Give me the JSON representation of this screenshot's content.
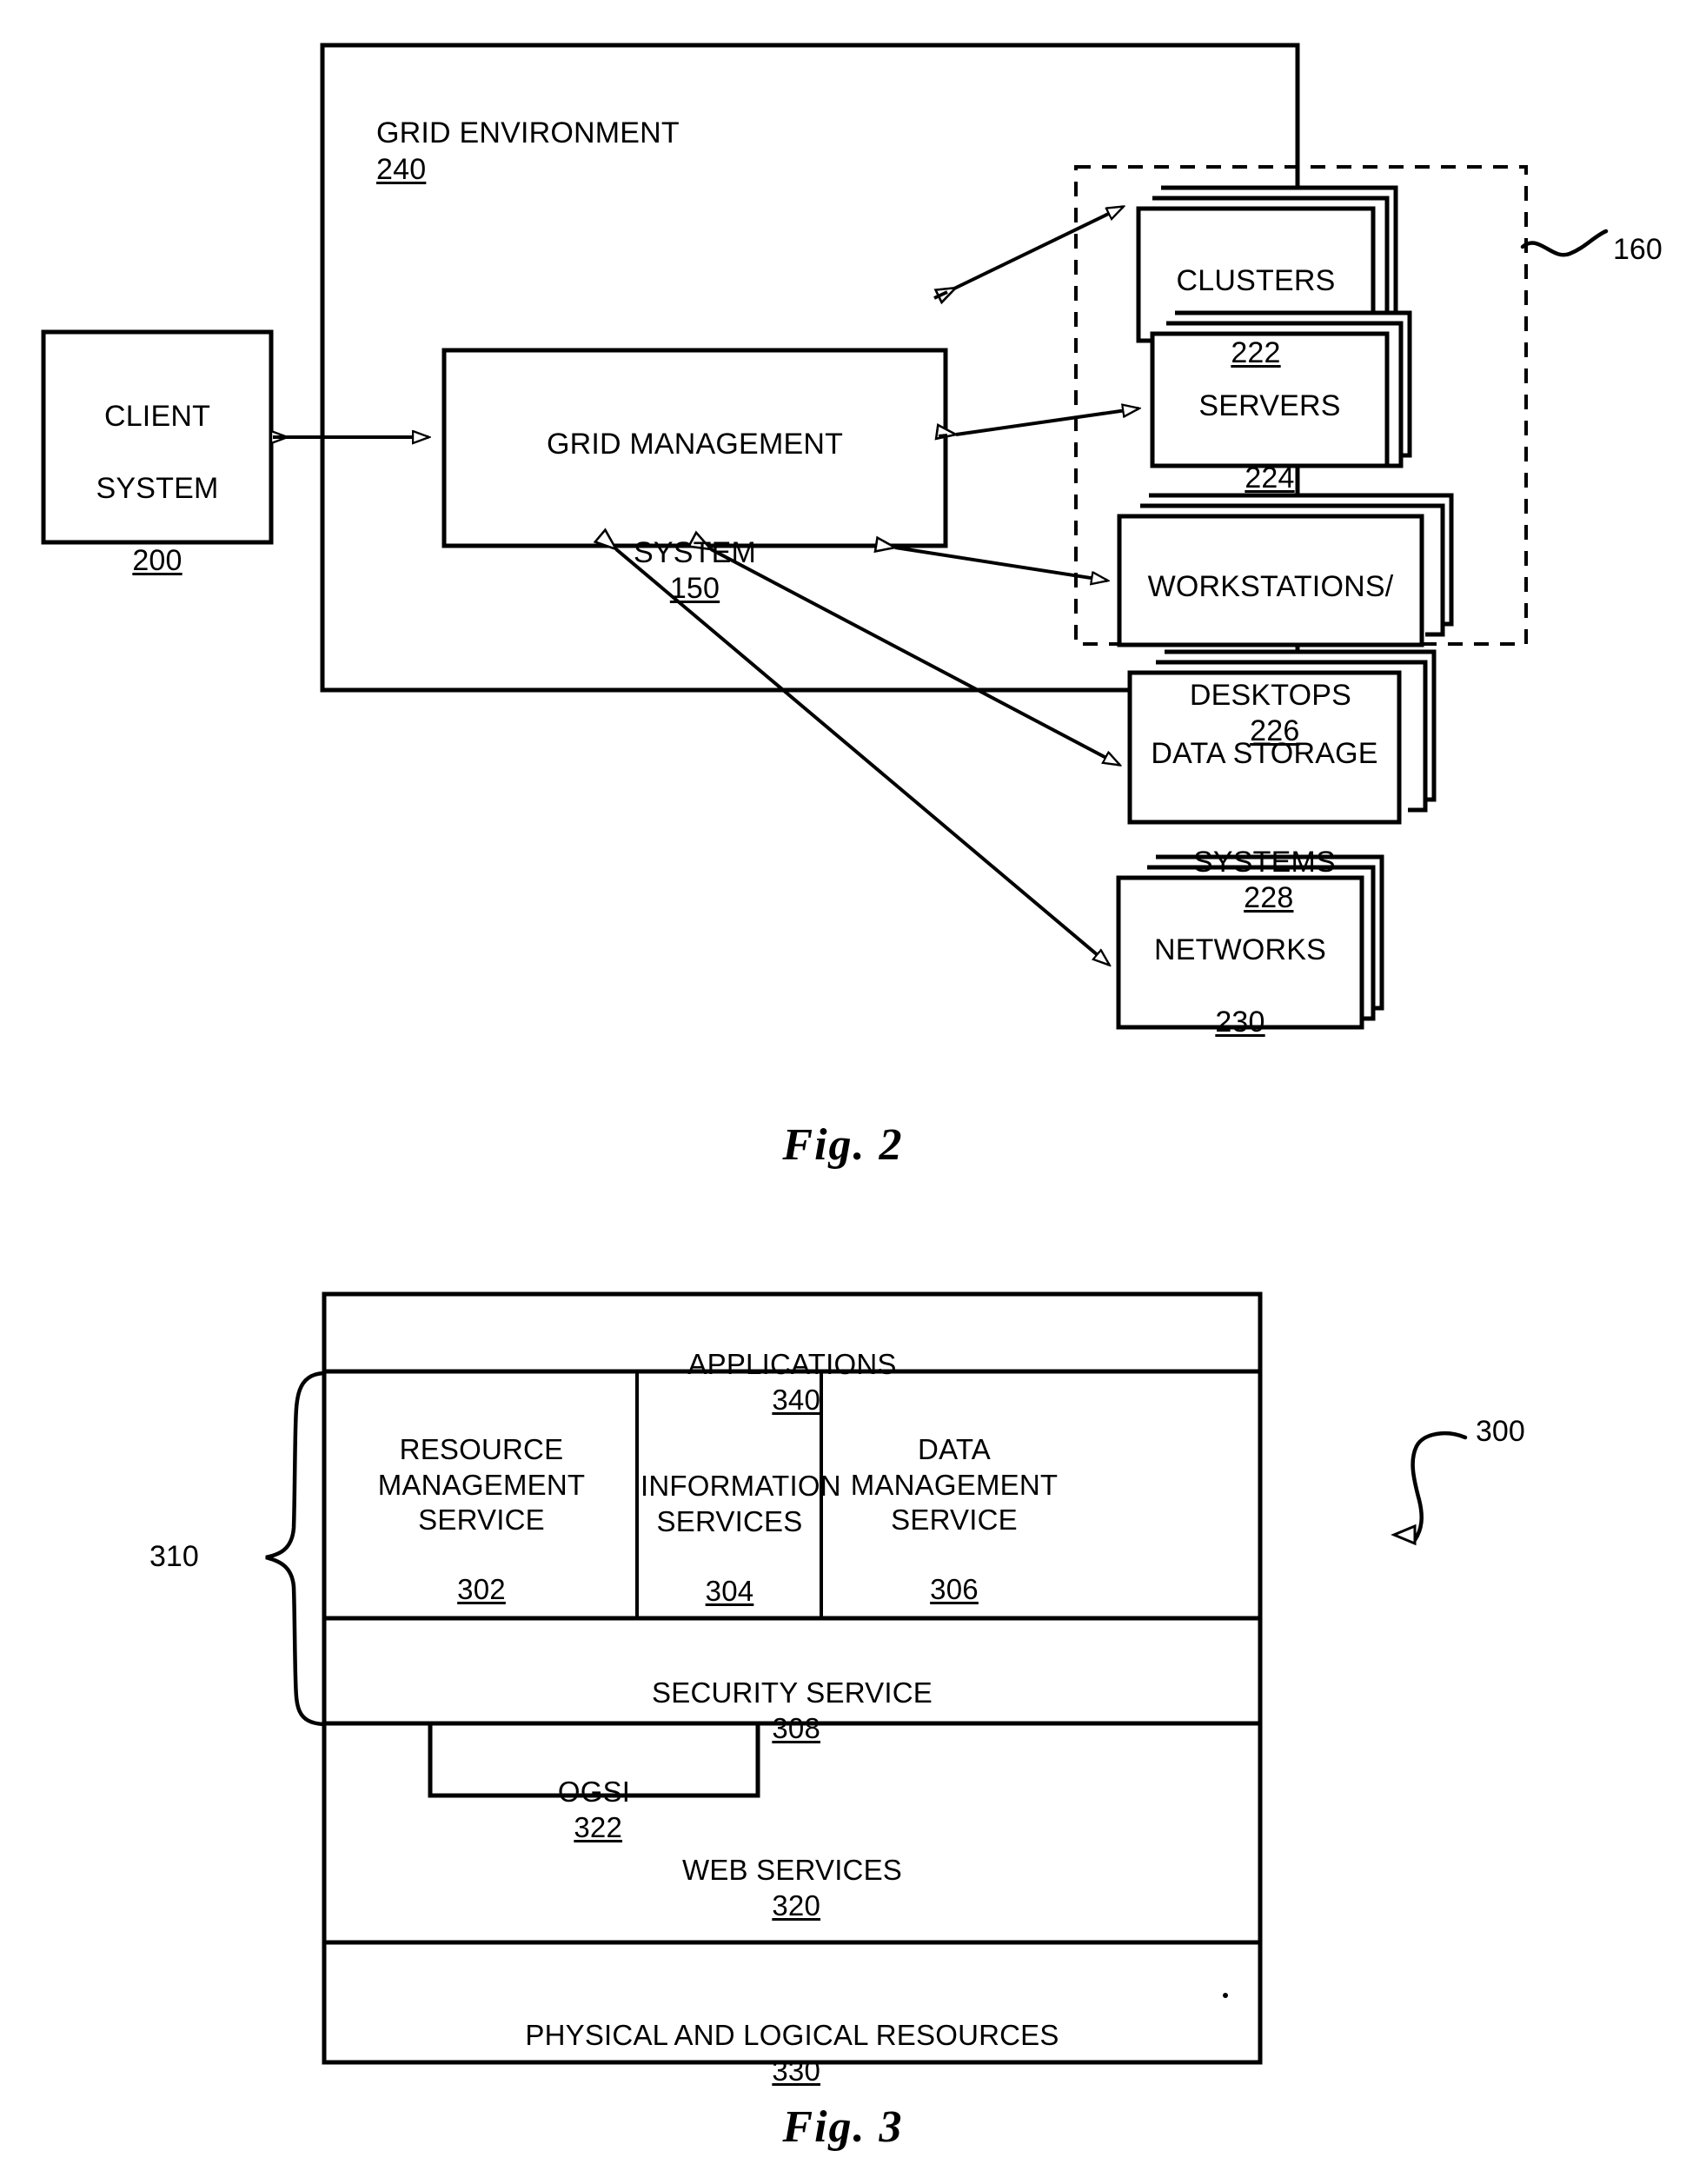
{
  "figure2": {
    "caption": "Fig. 2",
    "environment_title": "GRID ENVIRONMENT 240",
    "environment_title_text": "GRID ENVIRONMENT",
    "environment_ref": "240",
    "client_system": {
      "line1": "CLIENT",
      "line2": "SYSTEM",
      "ref": "200"
    },
    "grid_management_system": {
      "line1": "GRID MANAGEMENT",
      "line2": "SYSTEM",
      "ref": "150"
    },
    "resource_group_ref": "160",
    "resources": [
      {
        "name": "CLUSTERS",
        "ref": "222",
        "lines": 1
      },
      {
        "name": "SERVERS",
        "ref": "224",
        "lines": 1
      },
      {
        "name": "WORKSTATIONS/",
        "name2": "DESKTOPS",
        "ref": "226",
        "lines": 2
      },
      {
        "name": "DATA STORAGE",
        "name2": "SYSTEMS",
        "ref": "228",
        "lines": 2
      },
      {
        "name": "NETWORKS",
        "ref": "230",
        "lines": 1
      }
    ]
  },
  "figure3": {
    "caption": "Fig. 3",
    "architecture_ref": "300",
    "brace_ref": "310",
    "applications": {
      "label": "APPLICATIONS",
      "ref": "340"
    },
    "services": [
      {
        "label": "RESOURCE\nMANAGEMENT\nSERVICE",
        "ref": "302"
      },
      {
        "label": "INFORMATION\nSERVICES",
        "ref": "304"
      },
      {
        "label": "DATA\nMANAGEMENT\nSERVICE",
        "ref": "306"
      }
    ],
    "security_service": {
      "label": "SECURITY SERVICE",
      "ref": "308"
    },
    "ogsi": {
      "label": "OGSI",
      "ref": "322"
    },
    "web_services": {
      "label": "WEB SERVICES",
      "ref": "320"
    },
    "physical_logical_resources": {
      "label": "PHYSICAL AND LOGICAL RESOURCES",
      "ref": "330"
    }
  },
  "colors": {
    "ink": "#000000",
    "paper": "#ffffff"
  }
}
